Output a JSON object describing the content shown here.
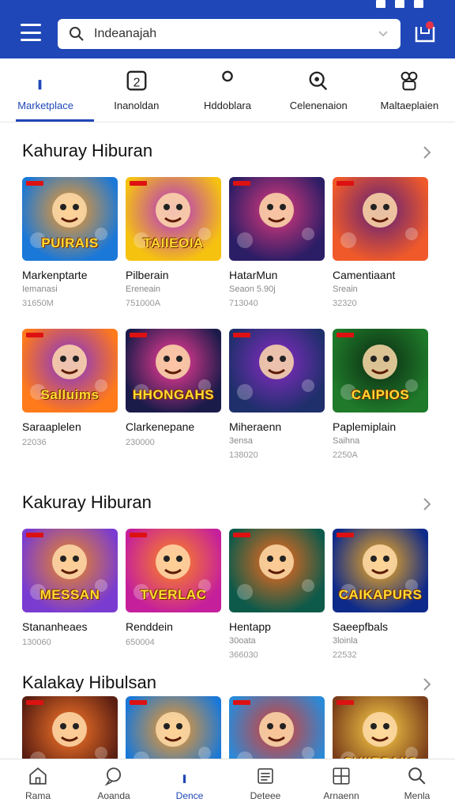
{
  "search": {
    "value": "Indeanajah"
  },
  "tabs": [
    {
      "label": "Marketplace",
      "icon": "thumbs-up-icon",
      "active": true
    },
    {
      "label": "Inanoldan",
      "icon": "square-number-icon",
      "active": false
    },
    {
      "label": "Hddoblara",
      "icon": "person-icon",
      "active": false
    },
    {
      "label": "Celenenaion",
      "icon": "magnifier-icon",
      "active": false
    },
    {
      "label": "Maltaeplaien",
      "icon": "people-icon",
      "active": false
    }
  ],
  "sections": [
    {
      "title": "Kahuray Hiburan",
      "cards": [
        {
          "name": "Markenptarte",
          "sub": "Iemanasi",
          "price": "31650M",
          "art": "PUIRAIS",
          "colors": [
            "#1a78d8",
            "#ff9a1f"
          ]
        },
        {
          "name": "Pilberain",
          "sub": "Ereneain",
          "price": "751000A",
          "art": "TAIIEOIA",
          "colors": [
            "#f6c210",
            "#b12cd2"
          ]
        },
        {
          "name": "HatarMun",
          "sub": "Seaon 5.90j",
          "price": "713040",
          "art": "",
          "colors": [
            "#2b1d66",
            "#e23a7d"
          ]
        },
        {
          "name": "Camentiaant",
          "sub": "Sreain",
          "price": "32320",
          "art": "",
          "colors": [
            "#f05a2a",
            "#5b1e7a"
          ]
        }
      ]
    },
    {
      "title": "",
      "cards": [
        {
          "name": "Saraaplelen",
          "sub": "",
          "price": "22036",
          "art": "Salluims",
          "colors": [
            "#ff7a1a",
            "#7e2fd8"
          ]
        },
        {
          "name": "Clarkenepane",
          "sub": "",
          "price": "230000",
          "art": "HHONGAHS",
          "colors": [
            "#1b1b4a",
            "#ff3d9a"
          ]
        },
        {
          "name": "Miheraenn",
          "sub": "3ensa",
          "price": "138020",
          "art": "",
          "colors": [
            "#1e2f6b",
            "#8a2bc4"
          ]
        },
        {
          "name": "Paplemiplain",
          "sub": "Saihna",
          "price": "2250A",
          "art": "CAIPIOS",
          "colors": [
            "#1f7a2a",
            "#0c2a12"
          ]
        }
      ]
    },
    {
      "title": "Kakuray Hiburan",
      "cards": [
        {
          "name": "Stananheaes",
          "sub": "",
          "price": "130060",
          "art": "MESSAN",
          "colors": [
            "#7a3bd1",
            "#f08a1c"
          ]
        },
        {
          "name": "Renddein",
          "sub": "",
          "price": "650004",
          "art": "TVERLAC",
          "colors": [
            "#c51f9c",
            "#ff8a1a"
          ]
        },
        {
          "name": "Hentapp",
          "sub": "30oata",
          "price": "366030",
          "art": "",
          "colors": [
            "#0d5a4a",
            "#ff6a1a"
          ]
        },
        {
          "name": "Saeepfbals",
          "sub": "3loinla",
          "price": "22532",
          "art": "CAIKAPURS",
          "colors": [
            "#0e2a8a",
            "#ffb21a"
          ]
        }
      ]
    },
    {
      "title": "Kalakay Hibulsan",
      "cards": [
        {
          "name": "",
          "sub": "",
          "price": "",
          "art": "",
          "colors": [
            "#5a1e12",
            "#ff7a2a"
          ]
        },
        {
          "name": "",
          "sub": "",
          "price": "",
          "art": "",
          "colors": [
            "#1a78d8",
            "#ff9a1f"
          ]
        },
        {
          "name": "",
          "sub": "",
          "price": "",
          "art": "",
          "colors": [
            "#2a8ad8",
            "#e23a2a"
          ]
        },
        {
          "name": "",
          "sub": "",
          "price": "",
          "art": "CHIIRPAIIS",
          "colors": [
            "#7a3e1a",
            "#ffd24a"
          ]
        }
      ]
    }
  ],
  "bottom_nav": [
    {
      "label": "Rama",
      "icon": "home-icon",
      "active": false
    },
    {
      "label": "Aoanda",
      "icon": "chat-icon",
      "active": false
    },
    {
      "label": "Dence",
      "icon": "thumbs-up-icon",
      "active": true
    },
    {
      "label": "Deteee",
      "icon": "list-icon",
      "active": false
    },
    {
      "label": "Arnaenn",
      "icon": "grid-icon",
      "active": false
    },
    {
      "label": "Menla",
      "icon": "search-icon",
      "active": false
    }
  ],
  "colors": {
    "brand": "#1f47b8"
  }
}
